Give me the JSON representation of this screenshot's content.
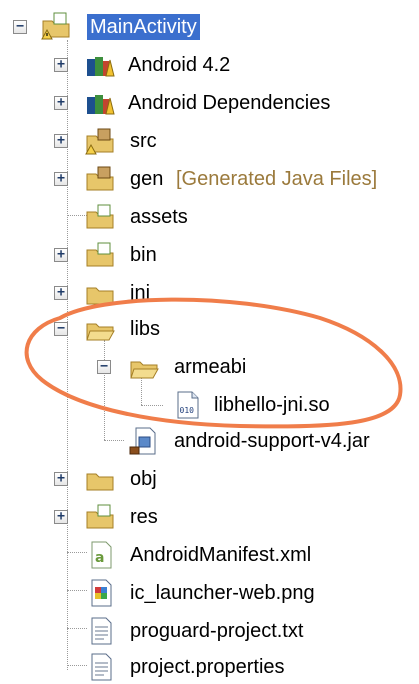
{
  "tree": {
    "root": {
      "label": "MainActivity"
    },
    "items": [
      {
        "label": "Android 4.2"
      },
      {
        "label": "Android Dependencies"
      },
      {
        "label": "src"
      },
      {
        "label": "gen",
        "suffix": "[Generated Java Files]"
      },
      {
        "label": "assets"
      },
      {
        "label": "bin"
      },
      {
        "label": "jni"
      },
      {
        "label": "libs"
      },
      {
        "label": "armeabi"
      },
      {
        "label": "libhello-jni.so"
      },
      {
        "label": "android-support-v4.jar"
      },
      {
        "label": "obj"
      },
      {
        "label": "res"
      },
      {
        "label": "AndroidManifest.xml"
      },
      {
        "label": "ic_launcher-web.png"
      },
      {
        "label": "proguard-project.txt"
      },
      {
        "label": "project.properties"
      }
    ]
  },
  "colors": {
    "selection": "#3b6fce",
    "generated_text": "#9b7a3c",
    "highlight_circle": "#f07d4a"
  }
}
